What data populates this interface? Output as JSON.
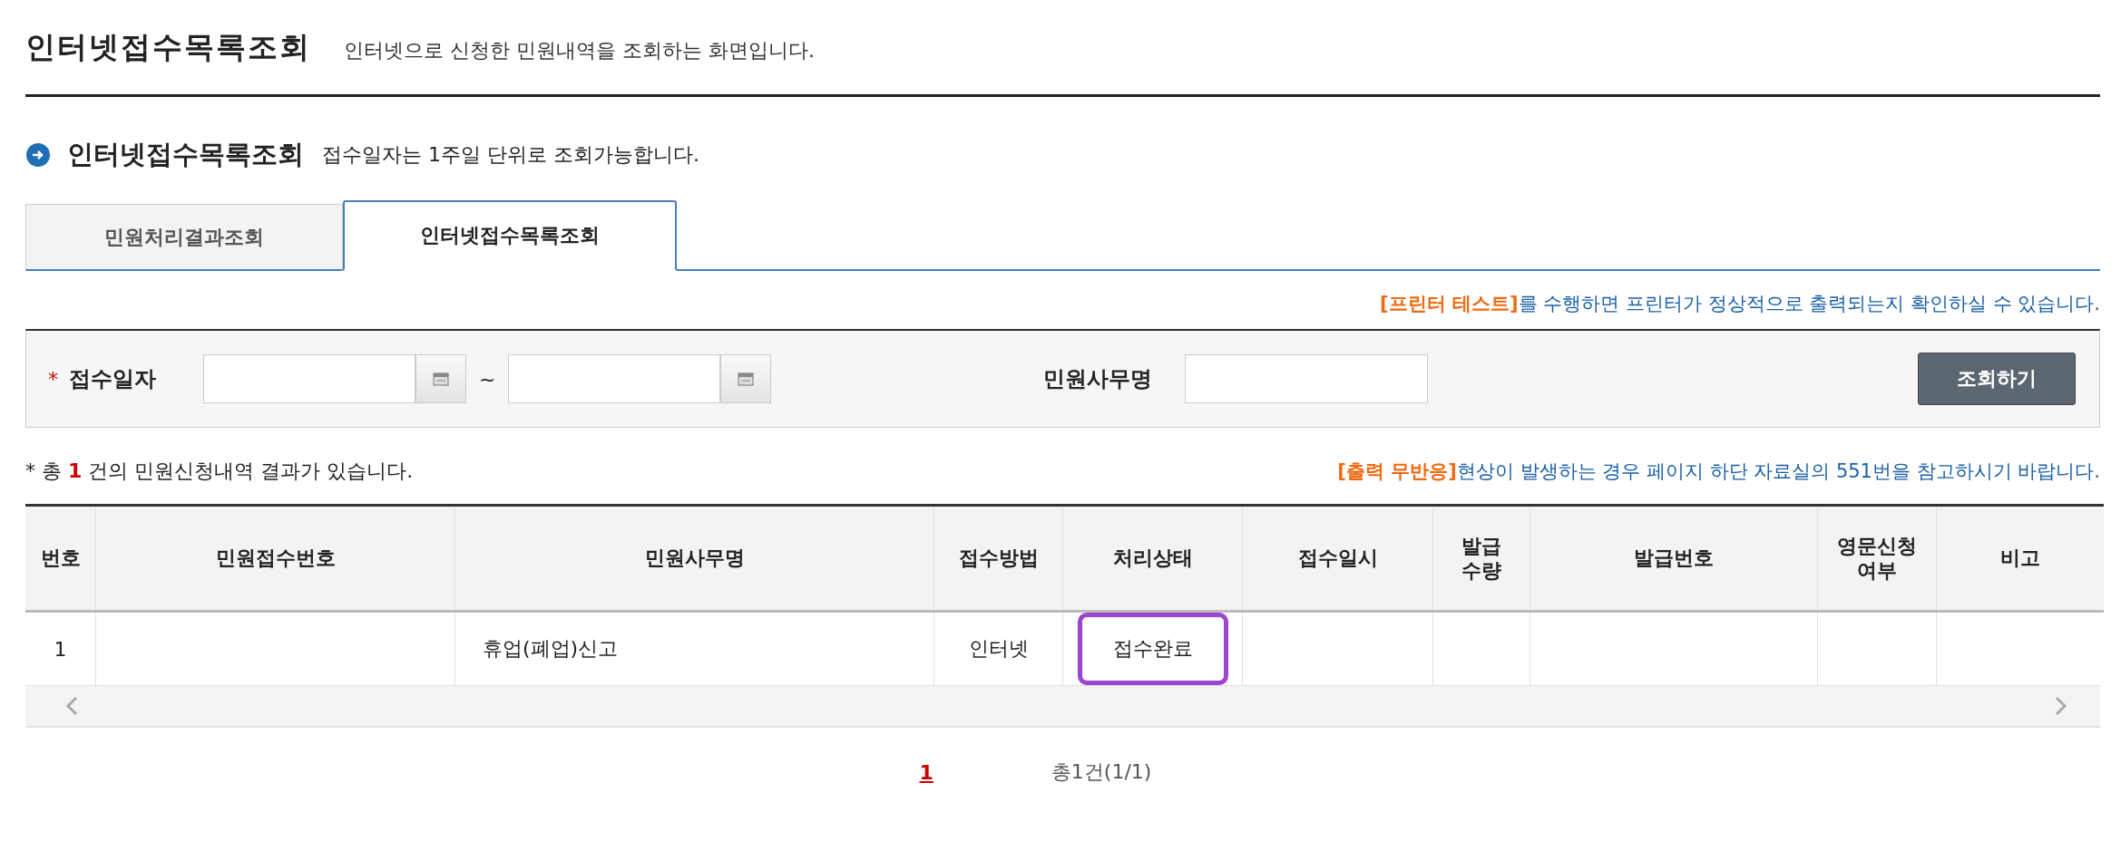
{
  "page_title": "인터넷접수목록조회",
  "page_subtitle": "인터넷으로 신청한 민원내역을 조회하는 화면입니다.",
  "section": {
    "title": "인터넷접수목록조회",
    "note": "접수일자는 1주일 단위로 조회가능합니다."
  },
  "tabs": [
    {
      "label": "민원처리결과조회",
      "selected": false
    },
    {
      "label": "인터넷접수목록조회",
      "selected": true
    }
  ],
  "printer_notice": {
    "highlight": "[프린터 테스트]",
    "text": "를 수행하면 프린터가 정상적으로 출력되는지 확인하실 수 있습니다."
  },
  "search": {
    "required_mark": "*",
    "date_label": "접수일자",
    "range_separator": "~",
    "name_label": "민원사무명",
    "button": "조회하기"
  },
  "result_summary": "* 총 **1** 건의 민원신청내역 결과가 있습니다.",
  "output_notice": {
    "highlight": "[출력 무반응]",
    "text": "현상이 발생하는 경우 페이지 하단 자료실의 551번을 참고하시기 바랍니다."
  },
  "table": {
    "columns": [
      "번호",
      "민원접수번호",
      "민원사무명",
      "접수방법",
      "처리상태",
      "접수일시",
      "발급\n수량",
      "발급번호",
      "영문신청\n여부",
      "비고"
    ],
    "rows": [
      {
        "cells": [
          {
            "text": "1",
            "highlighted": false
          },
          {},
          {
            "text": "휴업(폐업)신고",
            "highlighted": false
          },
          {
            "text": "인터넷",
            "highlighted": false
          },
          {
            "text": "접수완료",
            "highlighted": true
          },
          {},
          {},
          {},
          {},
          {}
        ]
      }
    ]
  },
  "pagination": {
    "pages": [
      {
        "label": "1",
        "selected": true
      }
    ],
    "total": "총1건(1/1)"
  }
}
